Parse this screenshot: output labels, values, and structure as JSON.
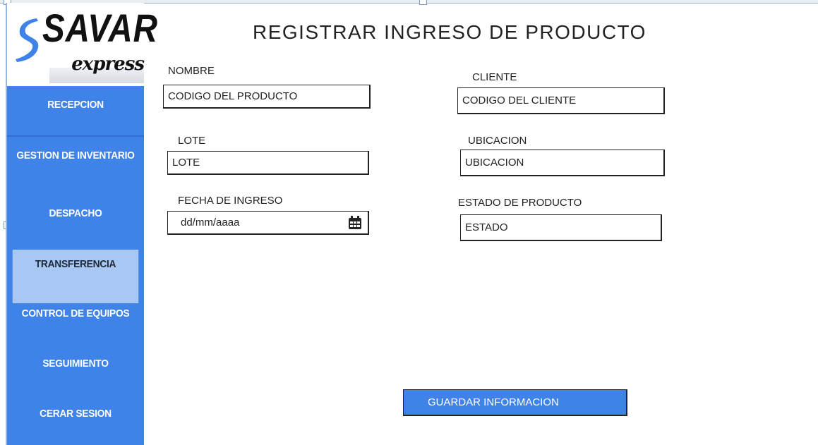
{
  "brand": {
    "name": "SAVAR",
    "sub": "express"
  },
  "sidebar": {
    "items": [
      {
        "label": "RECEPCION"
      },
      {
        "label": "GESTION DE INVENTARIO"
      },
      {
        "label": "DESPACHO"
      },
      {
        "label": "TRANSFERENCIA",
        "active": true
      },
      {
        "label": "CONTROL DE EQUIPOS"
      },
      {
        "label": "SEGUIMIENTO"
      },
      {
        "label": "CERAR SESION"
      }
    ]
  },
  "form": {
    "title": "REGISTRAR INGRESO DE PRODUCTO",
    "nombre": {
      "label": "NOMBRE",
      "value": "CODIGO DEL PRODUCTO"
    },
    "cliente": {
      "label": "CLIENTE",
      "value": "CODIGO DEL CLIENTE"
    },
    "lote": {
      "label": "LOTE",
      "value": "LOTE"
    },
    "ubicacion": {
      "label": "UBICACION",
      "value": "UBICACION"
    },
    "fecha": {
      "label": "FECHA DE INGRESO",
      "value": "dd/mm/aaaa",
      "icon": "calendar-icon"
    },
    "estado": {
      "label": "ESTADO DE PRODUCTO",
      "value": "ESTADO"
    },
    "save_label": "GUARDAR INFORMACION"
  },
  "colors": {
    "sidebar": "#3f82e8",
    "active": "#a9c7f3",
    "button": "#3f82e8"
  }
}
